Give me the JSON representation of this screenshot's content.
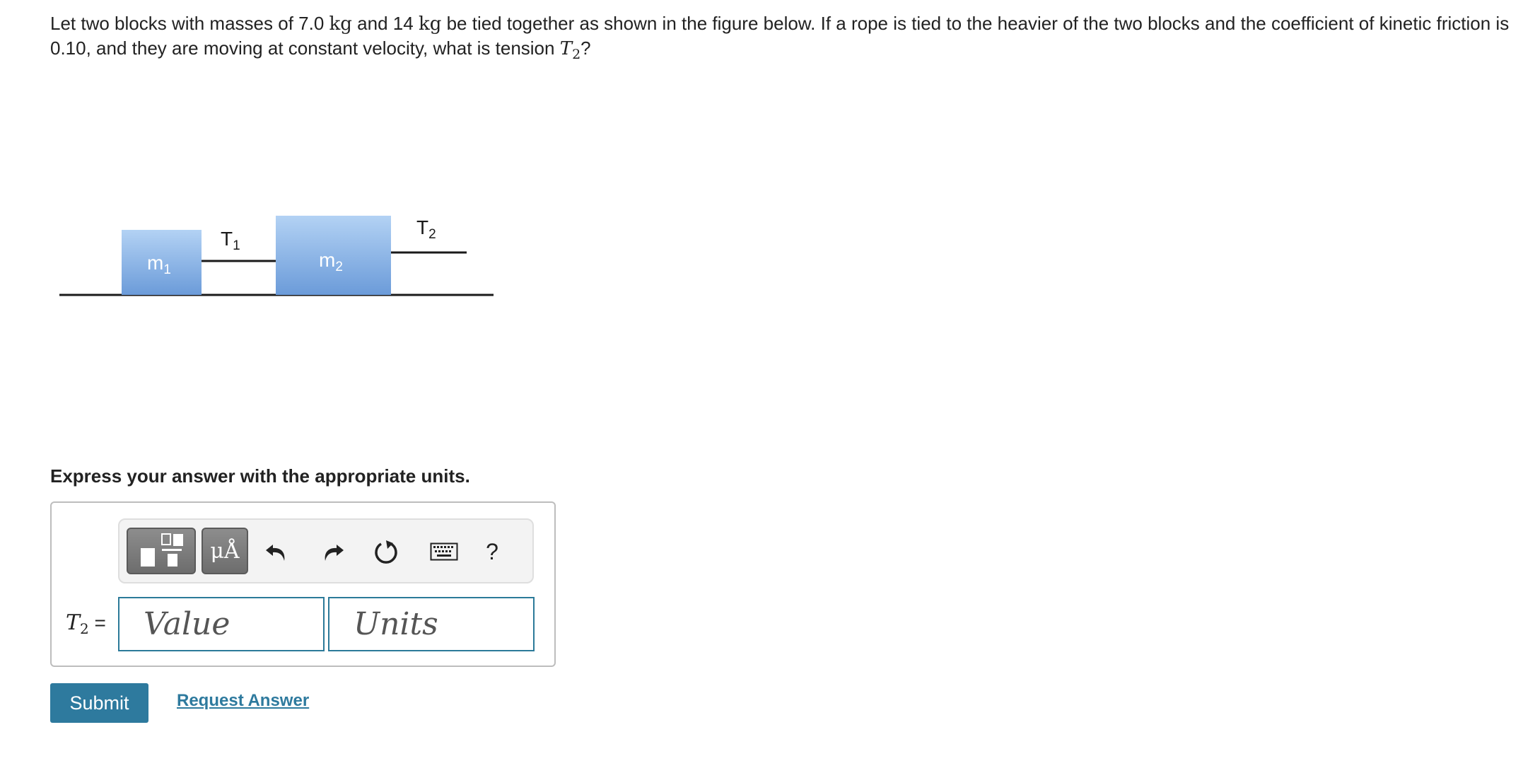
{
  "question": {
    "part1": "Let two blocks with masses of 7.0",
    "unit_a": "kg",
    "part2": "and 14",
    "unit_b": "kg",
    "part3": "be tied together as shown in the figure below. If a rope is tied to the heavier of the two blocks and the coefficient of kinetic friction is 0.10, and they are moving at constant velocity, what is tension",
    "var_symbol": "T",
    "var_sub": "2",
    "end": "?"
  },
  "figure": {
    "block1": {
      "label": "m",
      "sub": "1"
    },
    "block2": {
      "label": "m",
      "sub": "2"
    },
    "rope1": {
      "label": "T",
      "sub": "1"
    },
    "rope2": {
      "label": "T",
      "sub": "2"
    },
    "colors": {
      "block_top": "#b3d2f4",
      "block_bottom": "#6b9bd9",
      "line": "#1a1a1a"
    }
  },
  "instruction": "Express your answer with the appropriate units.",
  "toolbar": {
    "symbols_label": "μÅ",
    "help_label": "?"
  },
  "answer": {
    "var_symbol": "T",
    "var_sub": "2",
    "equals": "=",
    "value_placeholder": "Value",
    "units_placeholder": "Units"
  },
  "actions": {
    "submit_label": "Submit",
    "request_label": "Request Answer"
  },
  "colors": {
    "accent": "#2e7a9e",
    "input_border": "#2b7a99"
  }
}
